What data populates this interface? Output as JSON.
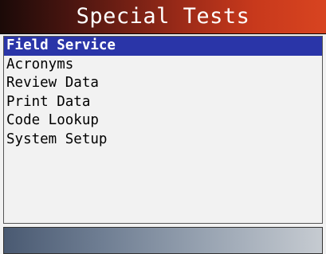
{
  "title": "Special Tests",
  "menu": {
    "items": [
      {
        "label": "Field Service",
        "selected": true
      },
      {
        "label": "Acronyms",
        "selected": false
      },
      {
        "label": "Review Data",
        "selected": false
      },
      {
        "label": "Print Data",
        "selected": false
      },
      {
        "label": "Code Lookup",
        "selected": false
      },
      {
        "label": "System Setup",
        "selected": false
      }
    ]
  },
  "colors": {
    "title_bar_dark": "#1b0a08",
    "title_bar_light": "#d84420",
    "selection": "#2a35a8",
    "background": "#f2f2f2"
  }
}
